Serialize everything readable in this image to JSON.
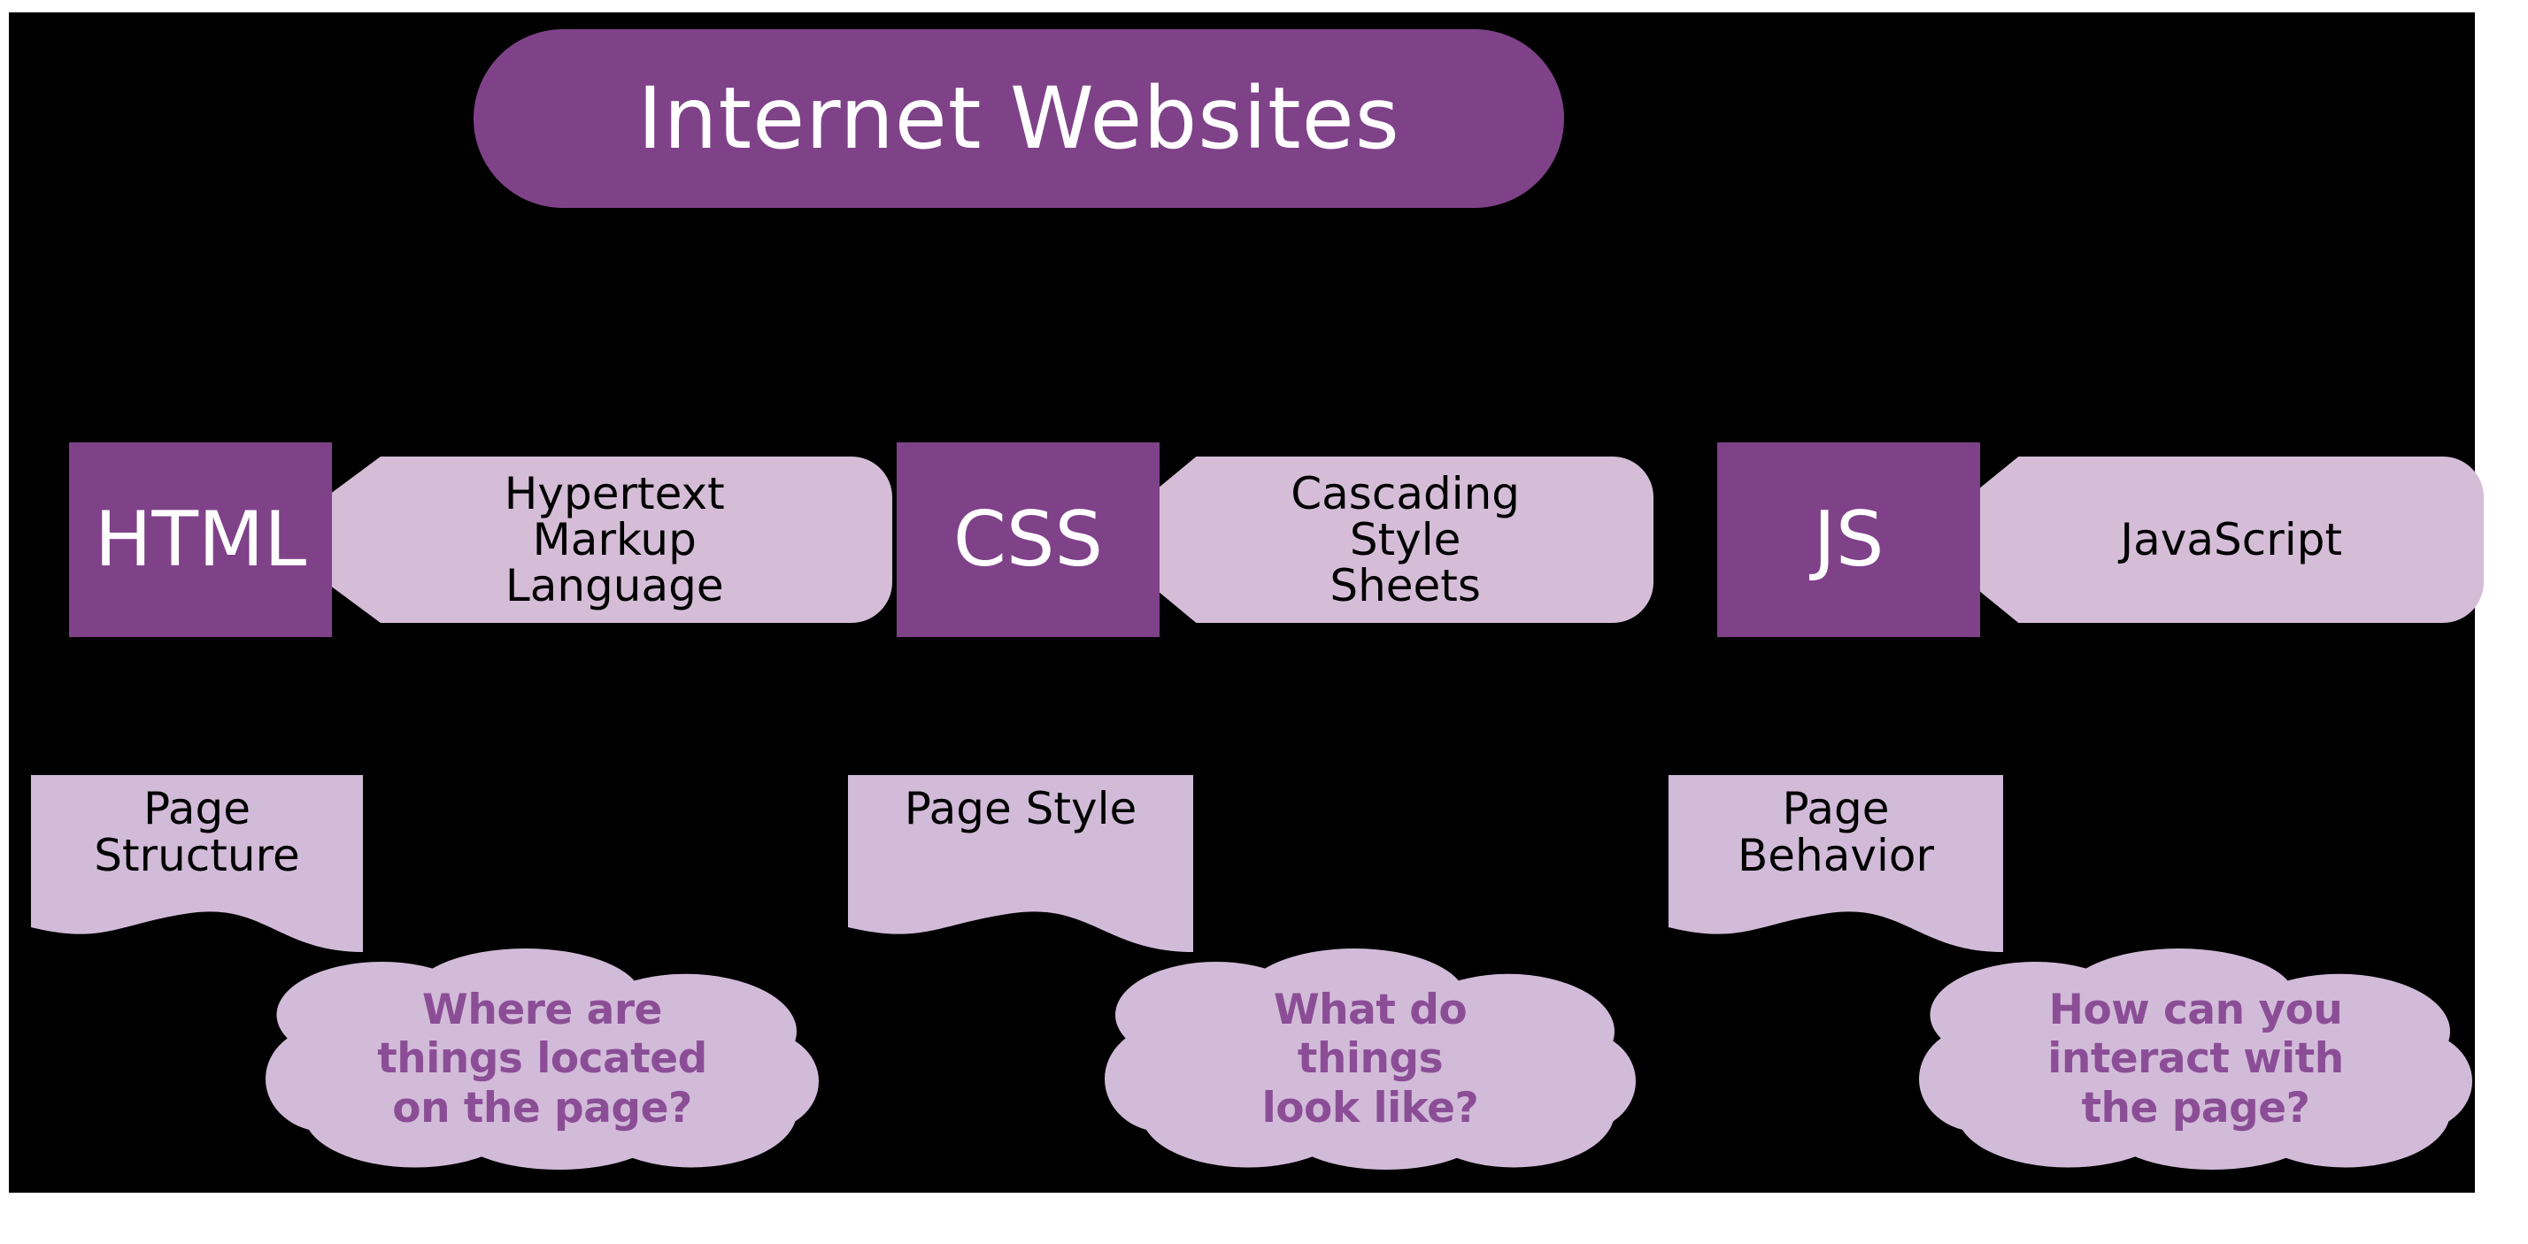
{
  "title": {
    "text": "Internet Websites"
  },
  "colors": {
    "background": "#000000",
    "accent_dark_purple": "#7F4289",
    "accent_light_lavender": "#D5BDD8",
    "banner_lavender": "#D2BBD9",
    "cloud_text_purple": "#8B4E96",
    "chip_text": "#FFFFFF",
    "arrow_text": "#000000"
  },
  "technologies": [
    {
      "abbreviation": "HTML",
      "expansion": "Hypertext\nMarkup\nLanguage",
      "banner": "Page\nStructure",
      "question": "Where are\nthings located\non the page?"
    },
    {
      "abbreviation": "CSS",
      "expansion": "Cascading\nStyle\nSheets",
      "banner": "Page Style",
      "question": "What do\nthings\nlook like?"
    },
    {
      "abbreviation": "JS",
      "expansion": "JavaScript",
      "banner": "Page\nBehavior",
      "question": "How can you\ninteract with\nthe page?"
    }
  ]
}
